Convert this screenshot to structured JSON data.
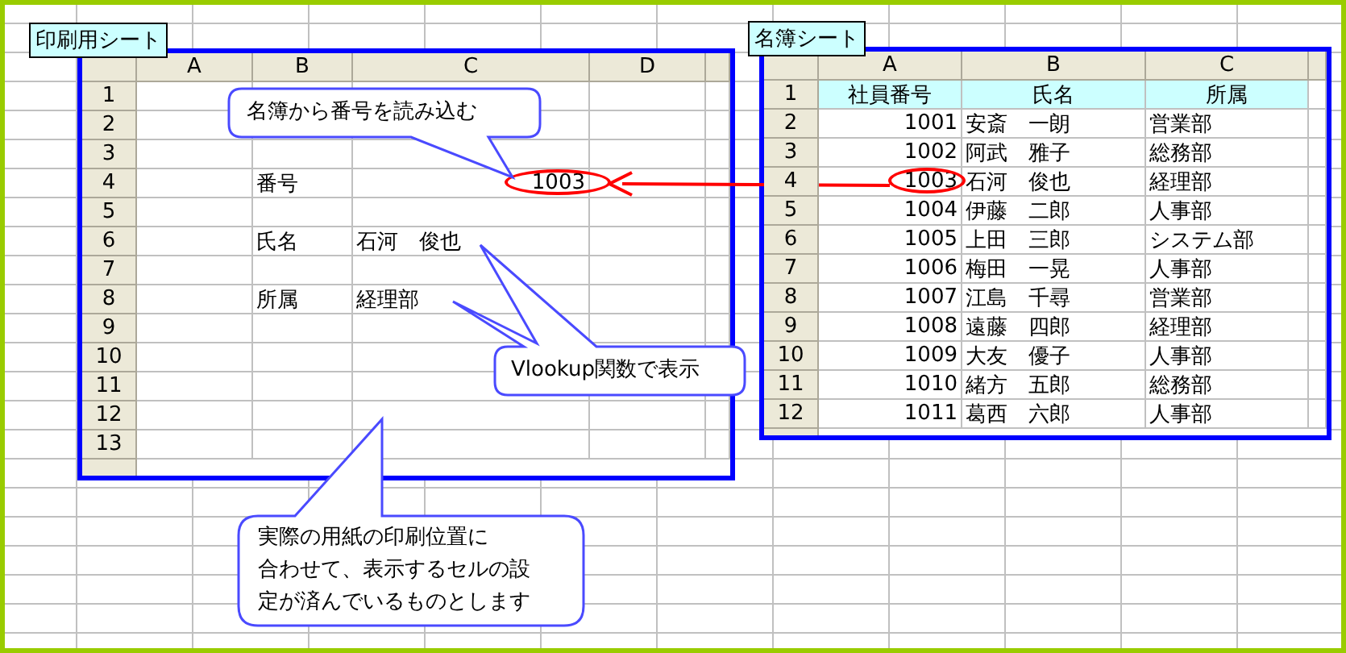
{
  "print_sheet": {
    "tab_label": "印刷用シート",
    "columns": [
      "A",
      "B",
      "C",
      "D"
    ],
    "rows": [
      {
        "header": "1",
        "kind": "blank",
        "circled": false
      },
      {
        "header": "2",
        "kind": "blank",
        "circled": false
      },
      {
        "header": "3",
        "kind": "blank",
        "circled": false
      },
      {
        "header": "4",
        "kind": "number",
        "b": "番号",
        "c": "1003",
        "circled": true
      },
      {
        "header": "5",
        "kind": "blank",
        "circled": false
      },
      {
        "header": "6",
        "kind": "text",
        "b": "氏名",
        "c": "石河　俊也",
        "circled": false
      },
      {
        "header": "7",
        "kind": "blank",
        "circled": false
      },
      {
        "header": "8",
        "kind": "text",
        "b": "所属",
        "c": "経理部",
        "circled": false
      },
      {
        "header": "9",
        "kind": "blank",
        "circled": false
      },
      {
        "header": "10",
        "kind": "blank",
        "circled": false
      },
      {
        "header": "11",
        "kind": "blank",
        "circled": false
      },
      {
        "header": "12",
        "kind": "blank",
        "circled": false
      },
      {
        "header": "13",
        "kind": "blank",
        "circled": false
      }
    ]
  },
  "roster_sheet": {
    "tab_label": "名簿シート",
    "columns": [
      "A",
      "B",
      "C"
    ],
    "rows": [
      {
        "header": "1",
        "a": "社員番号",
        "b": "氏名",
        "c": "所属",
        "highlighted": true,
        "circled": false
      },
      {
        "header": "2",
        "a": "1001",
        "b": "安斎　一朗",
        "c": "営業部",
        "highlighted": false,
        "circled": false
      },
      {
        "header": "3",
        "a": "1002",
        "b": "阿武　雅子",
        "c": "総務部",
        "highlighted": false,
        "circled": false
      },
      {
        "header": "4",
        "a": "1003",
        "b": "石河　俊也",
        "c": "経理部",
        "highlighted": false,
        "circled": true
      },
      {
        "header": "5",
        "a": "1004",
        "b": "伊藤　二郎",
        "c": "人事部",
        "highlighted": false,
        "circled": false
      },
      {
        "header": "6",
        "a": "1005",
        "b": "上田　三郎",
        "c": "システム部",
        "highlighted": false,
        "circled": false
      },
      {
        "header": "7",
        "a": "1006",
        "b": "梅田　一晃",
        "c": "人事部",
        "highlighted": false,
        "circled": false
      },
      {
        "header": "8",
        "a": "1007",
        "b": "江島　千尋",
        "c": "営業部",
        "highlighted": false,
        "circled": false
      },
      {
        "header": "9",
        "a": "1008",
        "b": "遠藤　四郎",
        "c": "経理部",
        "highlighted": false,
        "circled": false
      },
      {
        "header": "10",
        "a": "1009",
        "b": "大友　優子",
        "c": "人事部",
        "highlighted": false,
        "circled": false
      },
      {
        "header": "11",
        "a": "1010",
        "b": "緒方　五郎",
        "c": "総務部",
        "highlighted": false,
        "circled": false
      },
      {
        "header": "12",
        "a": "1011",
        "b": "葛西　六郎",
        "c": "人事部",
        "highlighted": false,
        "circled": false
      }
    ]
  },
  "callouts": [
    {
      "lines": [
        "名簿から番号を読み込む"
      ]
    },
    {
      "lines": [
        "Vlookup関数で表示"
      ]
    },
    {
      "lines": [
        "実際の用紙の印刷位置に",
        "合わせて、表示するセルの設",
        "定が済んでいるものとします"
      ]
    }
  ]
}
